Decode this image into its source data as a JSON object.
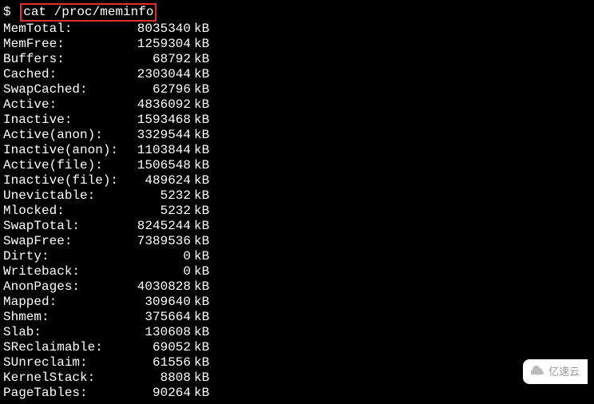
{
  "prompt": "$",
  "command": "cat /proc/meminfo",
  "unit": "kB",
  "rows": [
    {
      "label": "MemTotal:",
      "value": "8035340"
    },
    {
      "label": "MemFree:",
      "value": "1259304"
    },
    {
      "label": "Buffers:",
      "value": "68792"
    },
    {
      "label": "Cached:",
      "value": "2303044"
    },
    {
      "label": "SwapCached:",
      "value": "62796"
    },
    {
      "label": "Active:",
      "value": "4836092"
    },
    {
      "label": "Inactive:",
      "value": "1593468"
    },
    {
      "label": "Active(anon):",
      "value": "3329544"
    },
    {
      "label": "Inactive(anon):",
      "value": "1103844"
    },
    {
      "label": "Active(file):",
      "value": "1506548"
    },
    {
      "label": "Inactive(file):",
      "value": "489624"
    },
    {
      "label": "Unevictable:",
      "value": "5232"
    },
    {
      "label": "Mlocked:",
      "value": "5232"
    },
    {
      "label": "SwapTotal:",
      "value": "8245244"
    },
    {
      "label": "SwapFree:",
      "value": "7389536"
    },
    {
      "label": "Dirty:",
      "value": "0"
    },
    {
      "label": "Writeback:",
      "value": "0"
    },
    {
      "label": "AnonPages:",
      "value": "4030828"
    },
    {
      "label": "Mapped:",
      "value": "309640"
    },
    {
      "label": "Shmem:",
      "value": "375664"
    },
    {
      "label": "Slab:",
      "value": "130608"
    },
    {
      "label": "SReclaimable:",
      "value": "69052"
    },
    {
      "label": "SUnreclaim:",
      "value": "61556"
    },
    {
      "label": "KernelStack:",
      "value": "8808"
    },
    {
      "label": "PageTables:",
      "value": "90264"
    }
  ],
  "watermark": "亿速云"
}
